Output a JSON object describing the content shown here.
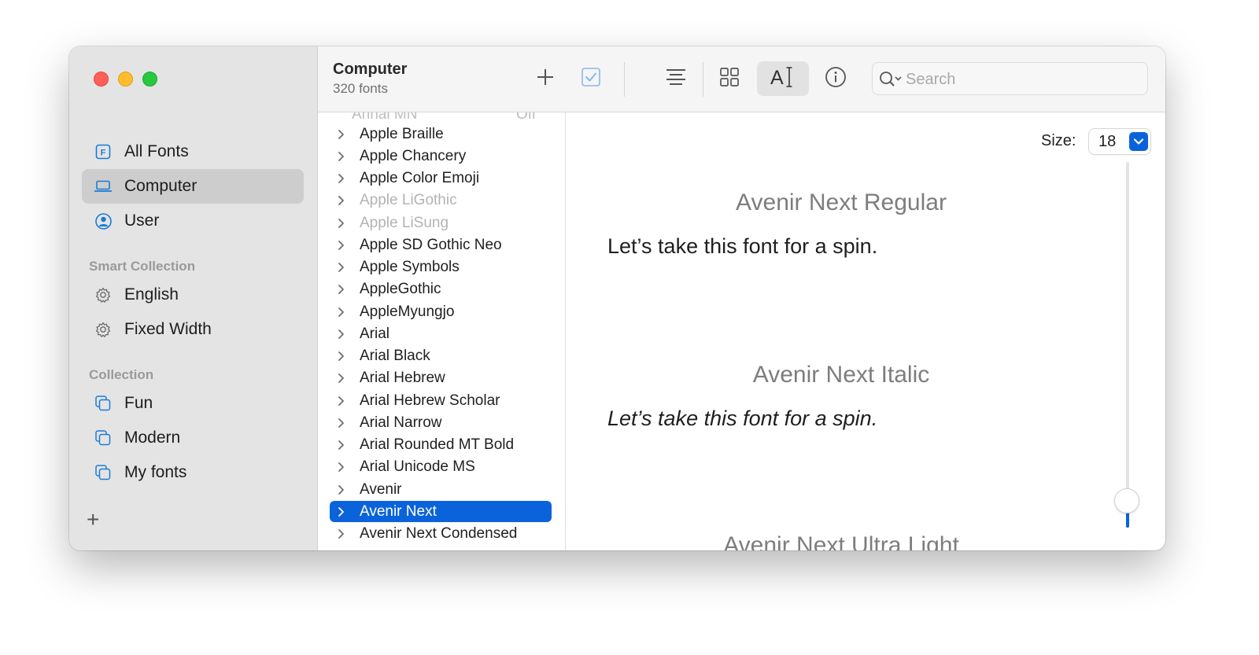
{
  "window": {
    "traffic_lights": [
      "close",
      "minimize",
      "zoom"
    ]
  },
  "sidebar": {
    "library_items": [
      {
        "label": "All Fonts",
        "icon": "font-book-icon",
        "selected": false
      },
      {
        "label": "Computer",
        "icon": "laptop-icon",
        "selected": true
      },
      {
        "label": "User",
        "icon": "user-icon",
        "selected": false
      }
    ],
    "smart_collection_header": "Smart Collection",
    "smart_collections": [
      {
        "label": "English",
        "icon": "gear-icon"
      },
      {
        "label": "Fixed Width",
        "icon": "gear-icon"
      }
    ],
    "collection_header": "Collection",
    "collections": [
      {
        "label": "Fun",
        "icon": "collection-icon"
      },
      {
        "label": "Modern",
        "icon": "collection-icon"
      },
      {
        "label": "My fonts",
        "icon": "collection-icon"
      }
    ],
    "add_label": "+"
  },
  "toolbar": {
    "title": "Computer",
    "subtitle": "320 fonts",
    "search_placeholder": "Search",
    "buttons": [
      "add-icon",
      "checkbox-icon",
      "align-center-icon",
      "grid-icon",
      "sample-text-icon",
      "info-icon"
    ]
  },
  "font_list": {
    "partial_top": {
      "name": "Annai MN",
      "status": "Off"
    },
    "items": [
      {
        "name": "Apple Braille",
        "dim": false
      },
      {
        "name": "Apple Chancery",
        "dim": false
      },
      {
        "name": "Apple Color Emoji",
        "dim": false
      },
      {
        "name": "Apple LiGothic",
        "dim": true
      },
      {
        "name": "Apple LiSung",
        "dim": true
      },
      {
        "name": "Apple SD Gothic Neo",
        "dim": false
      },
      {
        "name": "Apple Symbols",
        "dim": false
      },
      {
        "name": "AppleGothic",
        "dim": false
      },
      {
        "name": "AppleMyungjo",
        "dim": false
      },
      {
        "name": "Arial",
        "dim": false
      },
      {
        "name": "Arial Black",
        "dim": false
      },
      {
        "name": "Arial Hebrew",
        "dim": false
      },
      {
        "name": "Arial Hebrew Scholar",
        "dim": false
      },
      {
        "name": "Arial Narrow",
        "dim": false
      },
      {
        "name": "Arial Rounded MT Bold",
        "dim": false
      },
      {
        "name": "Arial Unicode MS",
        "dim": false
      },
      {
        "name": "Avenir",
        "dim": false
      },
      {
        "name": "Avenir Next",
        "dim": false,
        "selected": true
      },
      {
        "name": "Avenir Next Condensed",
        "dim": false
      }
    ]
  },
  "preview": {
    "size_label": "Size:",
    "size_value": "18",
    "size_slider_level": 0.1,
    "faces": [
      {
        "name": "Avenir Next Regular",
        "sample": "Let’s take this font for a spin.",
        "italic": false
      },
      {
        "name": "Avenir Next Italic",
        "sample": "Let’s take this font for a spin.",
        "italic": true
      },
      {
        "name": "Avenir Next Ultra Light",
        "sample": "",
        "italic": false
      }
    ]
  },
  "colors": {
    "accent": "#0a63db",
    "sidebar_bg": "#e4e4e4",
    "selected_sidebar": "#cdcdcd"
  }
}
